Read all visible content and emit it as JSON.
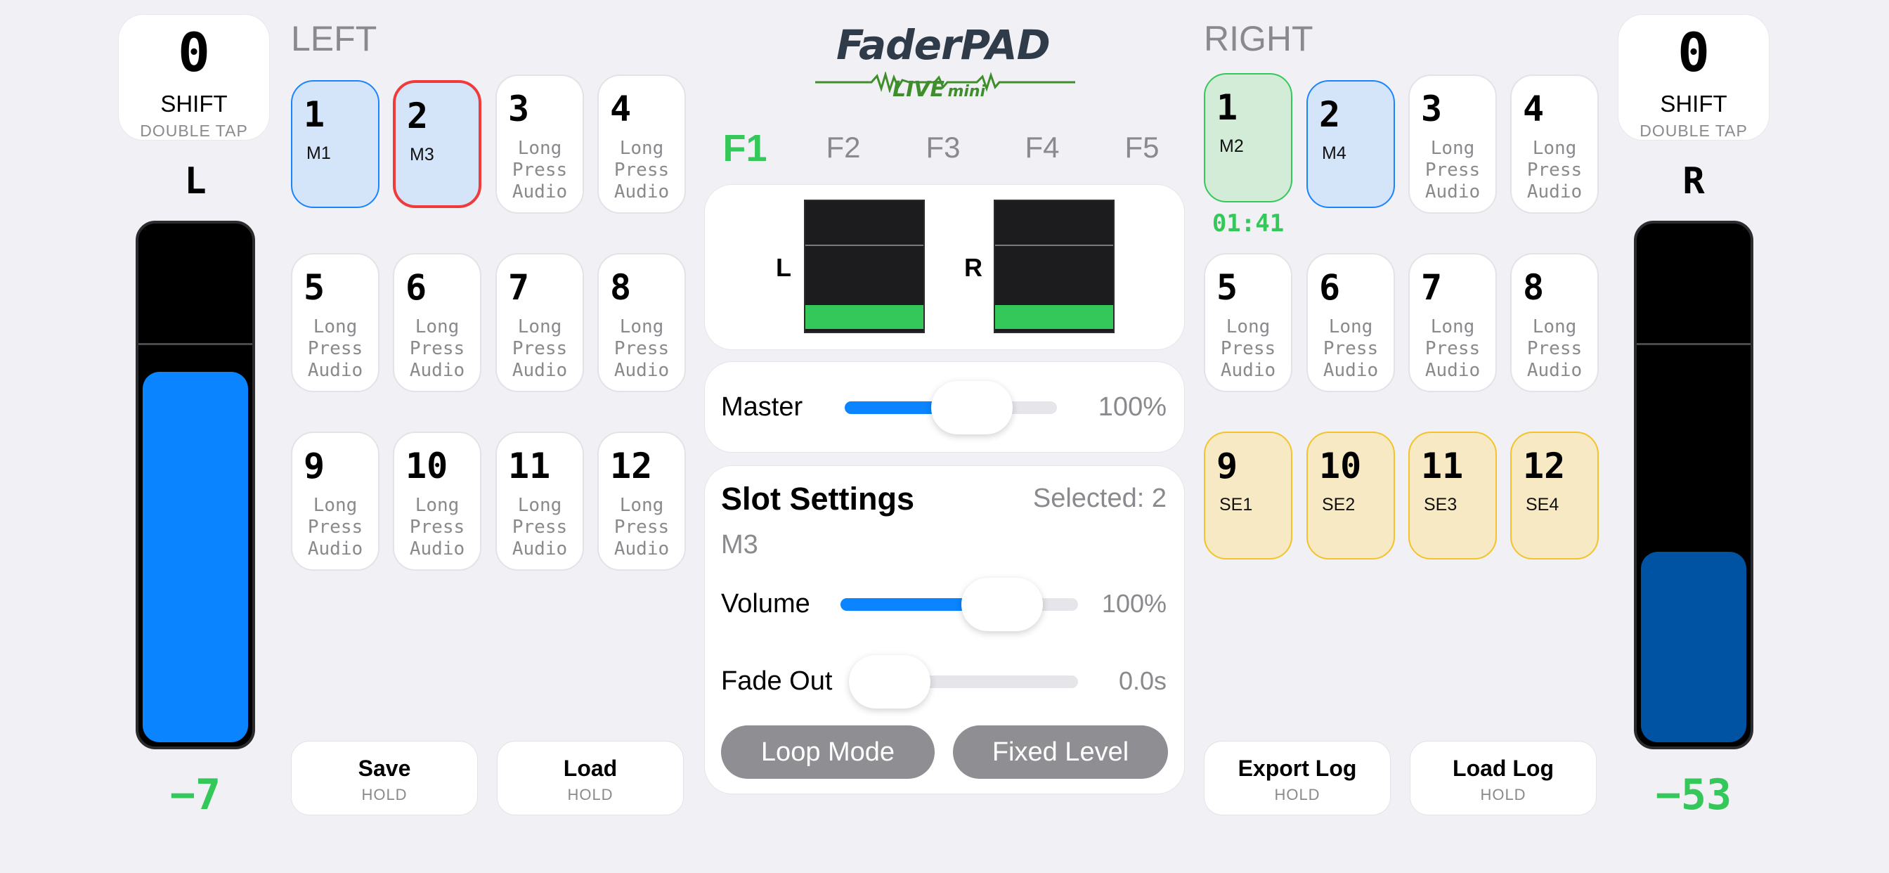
{
  "left": {
    "shift": {
      "count": "0",
      "label": "SHIFT",
      "sub": "DOUBLE TAP"
    },
    "channel": "L",
    "fader_level": 0.72,
    "fader_value": "−7",
    "section_title": "LEFT",
    "pads": [
      {
        "num": "1",
        "label": "M1"
      },
      {
        "num": "2",
        "label": "M3"
      },
      {
        "num": "3",
        "l1": "Long",
        "l2": "Press",
        "l3": "Audio"
      },
      {
        "num": "4",
        "l1": "Long",
        "l2": "Press",
        "l3": "Audio"
      },
      {
        "num": "5",
        "l1": "Long",
        "l2": "Press",
        "l3": "Audio"
      },
      {
        "num": "6",
        "l1": "Long",
        "l2": "Press",
        "l3": "Audio"
      },
      {
        "num": "7",
        "l1": "Long",
        "l2": "Press",
        "l3": "Audio"
      },
      {
        "num": "8",
        "l1": "Long",
        "l2": "Press",
        "l3": "Audio"
      },
      {
        "num": "9",
        "l1": "Long",
        "l2": "Press",
        "l3": "Audio"
      },
      {
        "num": "10",
        "l1": "Long",
        "l2": "Press",
        "l3": "Audio"
      },
      {
        "num": "11",
        "l1": "Long",
        "l2": "Press",
        "l3": "Audio"
      },
      {
        "num": "12",
        "l1": "Long",
        "l2": "Press",
        "l3": "Audio"
      }
    ],
    "buttons": [
      {
        "title": "Save",
        "sub": "HOLD"
      },
      {
        "title": "Load",
        "sub": "HOLD"
      }
    ]
  },
  "right": {
    "shift": {
      "count": "0",
      "label": "SHIFT",
      "sub": "DOUBLE TAP"
    },
    "channel": "R",
    "fader_level": 0.37,
    "fader_value": "−53",
    "section_title": "RIGHT",
    "timer": "01:41",
    "pads": [
      {
        "num": "1",
        "label": "M2"
      },
      {
        "num": "2",
        "label": "M4"
      },
      {
        "num": "3",
        "l1": "Long",
        "l2": "Press",
        "l3": "Audio"
      },
      {
        "num": "4",
        "l1": "Long",
        "l2": "Press",
        "l3": "Audio"
      },
      {
        "num": "5",
        "l1": "Long",
        "l2": "Press",
        "l3": "Audio"
      },
      {
        "num": "6",
        "l1": "Long",
        "l2": "Press",
        "l3": "Audio"
      },
      {
        "num": "7",
        "l1": "Long",
        "l2": "Press",
        "l3": "Audio"
      },
      {
        "num": "8",
        "l1": "Long",
        "l2": "Press",
        "l3": "Audio"
      },
      {
        "num": "9",
        "label": "SE1"
      },
      {
        "num": "10",
        "label": "SE2"
      },
      {
        "num": "11",
        "label": "SE3"
      },
      {
        "num": "12",
        "label": "SE4"
      }
    ],
    "buttons": [
      {
        "title": "Export Log",
        "sub": "HOLD"
      },
      {
        "title": "Load Log",
        "sub": "HOLD"
      }
    ]
  },
  "logo": {
    "word1": "Fader",
    "word2": "PAD",
    "live": "LIVE",
    "mini": "mini"
  },
  "tabs": [
    "F1",
    "F2",
    "F3",
    "F4",
    "F5"
  ],
  "active_tab": "F1",
  "meters": {
    "left_label": "L",
    "right_label": "R"
  },
  "master": {
    "label": "Master",
    "value": "100%",
    "level": 0.6
  },
  "slot": {
    "title": "Slot Settings",
    "selected": "Selected: 2",
    "name": "M3",
    "volume": {
      "label": "Volume",
      "value": "100%",
      "level": 0.68
    },
    "fade": {
      "label": "Fade Out",
      "value": "0.0s",
      "level": 0.0
    },
    "loop_label": "Loop Mode",
    "fixed_label": "Fixed Level"
  },
  "colors": {
    "accent_green": "#34c759",
    "accent_blue": "#0a84ff",
    "red": "#ef3b3b",
    "yellow": "#f2c32b"
  }
}
